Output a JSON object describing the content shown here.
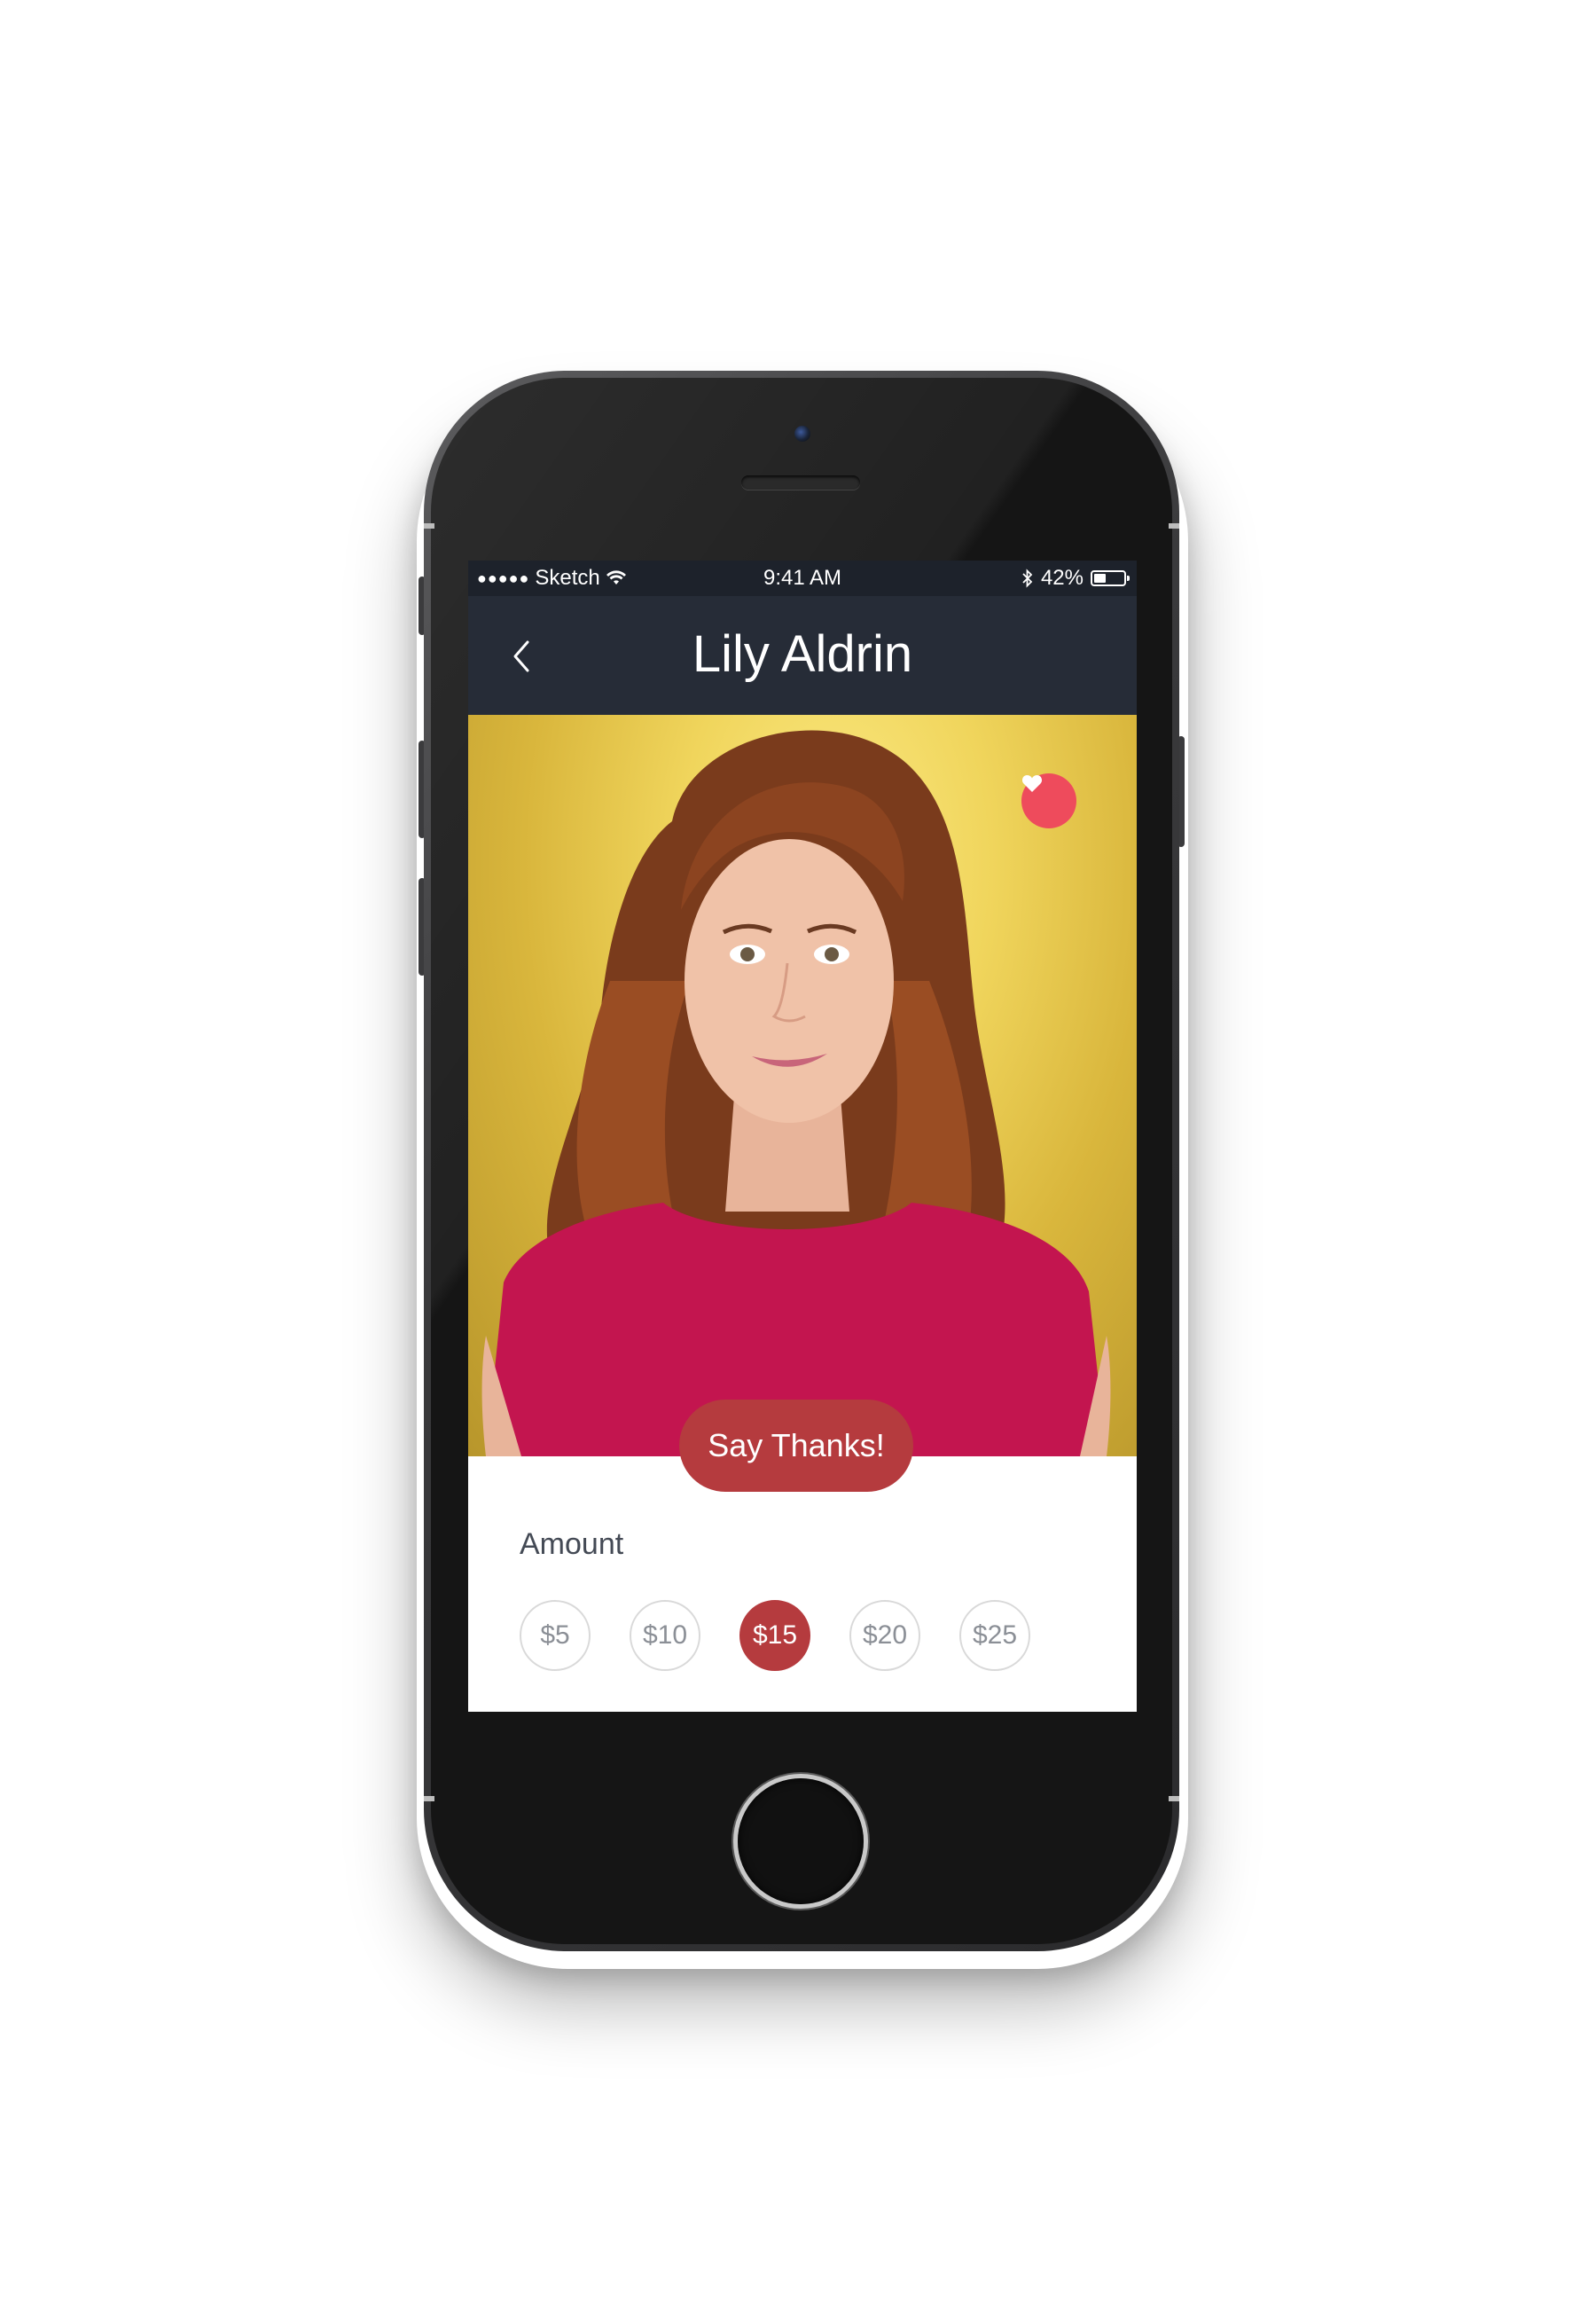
{
  "status_bar": {
    "signal_dots": "●●●●●",
    "carrier": "Sketch",
    "time": "9:41 AM",
    "battery_percent": "42%",
    "battery_level": 0.42
  },
  "nav": {
    "title": "Lily Aldrin",
    "back_icon": "chevron-left-icon"
  },
  "profile": {
    "favorite_icon": "heart-icon",
    "favorite_color": "#ee4b5c"
  },
  "cta": {
    "label": "Say Thanks!",
    "color": "#b53b3e"
  },
  "amount": {
    "label": "Amount",
    "options": [
      "$5",
      "$10",
      "$15",
      "$20",
      "$25"
    ],
    "selected_index": 2
  }
}
